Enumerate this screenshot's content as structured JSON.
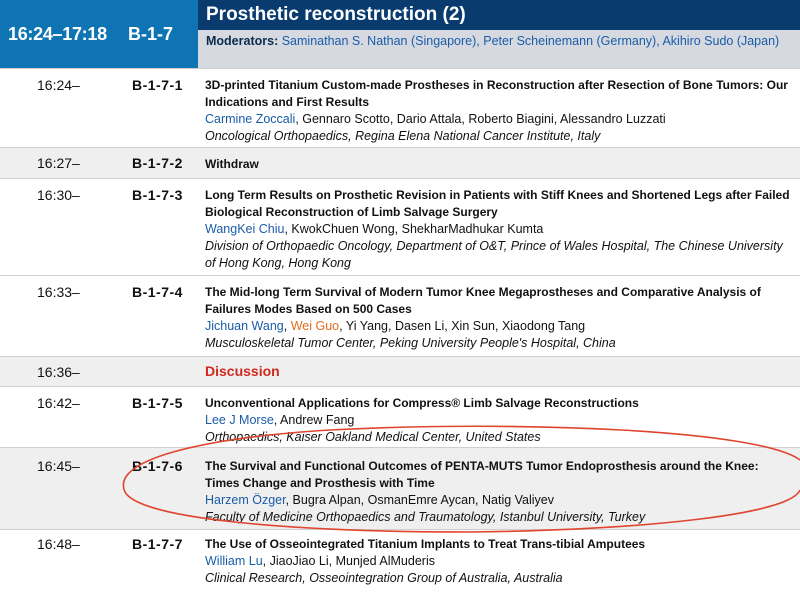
{
  "session": {
    "time": "16:24–17:18",
    "code": "B-1-7",
    "title": "Prosthetic reconstruction (2)",
    "moderators_label": "Moderators:",
    "moderators_names": "Saminathan S. Nathan (Singapore), Peter Scheinemann (Germany), Akihiro Sudo (Japan)"
  },
  "talks": [
    {
      "time": "16:24–",
      "code": "B-1-7-1",
      "title": "3D-printed Titanium Custom-made Prostheses in Reconstruction after Resection of Bone Tumors: Our Indications and First Results",
      "presenter": "Carmine Zoccali",
      "coauthors": ", Gennaro Scotto, Dario Attala, Roberto Biagini, Alessandro Luzzati",
      "affiliation": "Oncological Orthopaedics, Regina Elena National Cancer Institute, Italy"
    },
    {
      "time": "16:27–",
      "code": "B-1-7-2",
      "title": "Withdraw"
    },
    {
      "time": "16:30–",
      "code": "B-1-7-3",
      "title": "Long Term Results on Prosthetic Revision in Patients with Stiff Knees and Shortened Legs after Failed Biological Reconstruction of Limb Salvage Surgery",
      "presenter": "WangKei Chiu",
      "coauthors": ", KwokChuen Wong, ShekharMadhukar Kumta",
      "affiliation": "Division of Orthopaedic Oncology, Department of O&T, Prince of Wales Hospital, The Chinese University of Hong Kong, Hong Kong"
    },
    {
      "time": "16:33–",
      "code": "B-1-7-4",
      "title": "The Mid-long Term Survival of Modern Tumor Knee Megaprostheses and Comparative Analysis of Failures Modes Based on 500 Cases",
      "presenter": "Jichuan Wang",
      "sep": ", ",
      "presenter2": "Wei Guo",
      "coauthors": ", Yi Yang, Dasen Li, Xin Sun, Xiaodong Tang",
      "affiliation": "Musculoskeletal Tumor Center, Peking University People's Hospital, China"
    },
    {
      "time": "16:36–",
      "title": "Discussion"
    },
    {
      "time": "16:42–",
      "code": "B-1-7-5",
      "title": "Unconventional Applications for Compress® Limb Salvage Reconstructions",
      "presenter": "Lee J Morse",
      "coauthors": ", Andrew Fang",
      "affiliation": "Orthopaedics, Kaiser Oakland Medical Center, United States"
    },
    {
      "time": "16:45–",
      "code": "B-1-7-6",
      "title": "The Survival and Functional Outcomes of PENTA-MUTS Tumor Endoprosthesis around the Knee: Times Change and Prosthesis with Time",
      "presenter": "Harzem Özger",
      "coauthors": ", Bugra Alpan, OsmanEmre Aycan, Natig Valiyev",
      "affiliation": "Faculty of Medicine Orthopaedics and Traumatology, Istanbul University, Turkey"
    },
    {
      "time": "16:48–",
      "code": "B-1-7-7",
      "title": "The Use of Osseointegrated Titanium Implants to Treat Trans-tibial Amputees",
      "presenter": "William Lu",
      "coauthors": ", JiaoJiao Li, Munjed AlMuderis",
      "affiliation": "Clinical Research, Osseointegration Group of Australia, Australia"
    }
  ],
  "colors": {
    "time_block": "#0f74b3",
    "title_bar": "#0a3b6e",
    "presenter": "#1a5ca8",
    "highlight_presenter": "#e36b1e",
    "discussion": "#d0281e",
    "annotation_ellipse": "#e0452f"
  }
}
